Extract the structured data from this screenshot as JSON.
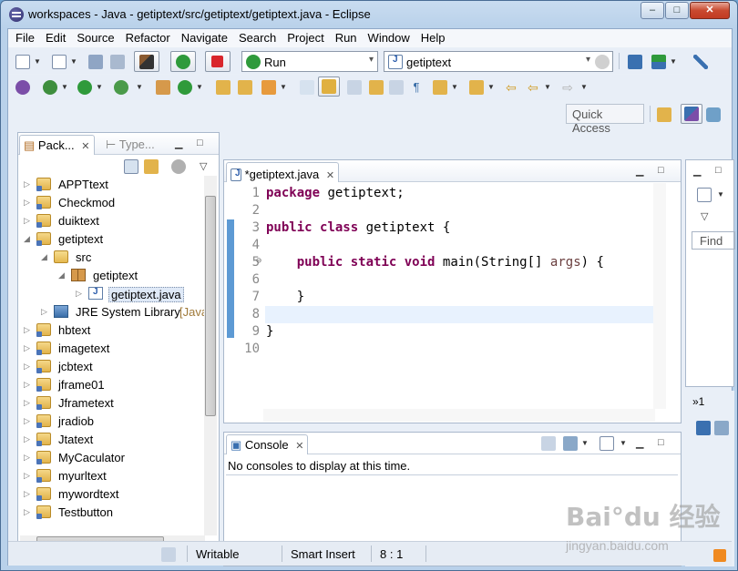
{
  "window": {
    "title": "workspaces - Java - getiptext/src/getiptext/getiptext.java - Eclipse",
    "min_label": "–",
    "max_label": "□",
    "close_label": "✕"
  },
  "menu": [
    "File",
    "Edit",
    "Source",
    "Refactor",
    "Navigate",
    "Search",
    "Project",
    "Run",
    "Window",
    "Help"
  ],
  "toolbar": {
    "launch_mode": "Run",
    "launch_config": "getiptext",
    "quick_access": "Quick Access"
  },
  "package_explorer": {
    "tab_active": "Pack...",
    "tab_other": "Type...",
    "tree": [
      {
        "label": "APPTtext",
        "level": 0,
        "type": "project",
        "expanded": false
      },
      {
        "label": "Checkmod",
        "level": 0,
        "type": "project",
        "expanded": false
      },
      {
        "label": "duiktext",
        "level": 0,
        "type": "project",
        "expanded": false
      },
      {
        "label": "getiptext",
        "level": 0,
        "type": "project",
        "expanded": true
      },
      {
        "label": "src",
        "level": 1,
        "type": "src",
        "expanded": true
      },
      {
        "label": "getiptext",
        "level": 2,
        "type": "package",
        "expanded": true
      },
      {
        "label": "getiptext.java",
        "level": 3,
        "type": "java",
        "expanded": false,
        "selected": true
      },
      {
        "label": "JRE System Library",
        "suffix": "[Java",
        "level": 1,
        "type": "jre",
        "expanded": false
      },
      {
        "label": "hbtext",
        "level": 0,
        "type": "project",
        "expanded": false
      },
      {
        "label": "imagetext",
        "level": 0,
        "type": "project",
        "expanded": false
      },
      {
        "label": "jcbtext",
        "level": 0,
        "type": "project",
        "expanded": false
      },
      {
        "label": "jframe01",
        "level": 0,
        "type": "project",
        "expanded": false
      },
      {
        "label": "Jframetext",
        "level": 0,
        "type": "project",
        "expanded": false
      },
      {
        "label": "jradiob",
        "level": 0,
        "type": "project",
        "expanded": false
      },
      {
        "label": "Jtatext",
        "level": 0,
        "type": "project",
        "expanded": false
      },
      {
        "label": "MyCaculator",
        "level": 0,
        "type": "project",
        "expanded": false
      },
      {
        "label": "myurltext",
        "level": 0,
        "type": "project",
        "expanded": false
      },
      {
        "label": "mywordtext",
        "level": 0,
        "type": "project",
        "expanded": false
      },
      {
        "label": "Testbutton",
        "level": 0,
        "type": "project",
        "expanded": false
      }
    ]
  },
  "editor": {
    "tab_label": "*getiptext.java",
    "line_numbers": [
      "1",
      "2",
      "3",
      "4",
      "5",
      "6",
      "7",
      "8",
      "9",
      "10"
    ],
    "fold_marker": "⊖"
  },
  "outline": {
    "find_placeholder": "Find",
    "mini_label": "»1"
  },
  "console": {
    "tab_label": "Console",
    "message": "No consoles to display at this time."
  },
  "status": {
    "writable": "Writable",
    "insert_mode": "Smart Insert",
    "position": "8 : 1"
  },
  "watermark": {
    "main": "Bai°du 经验",
    "sub": "jingyan.baidu.com"
  }
}
